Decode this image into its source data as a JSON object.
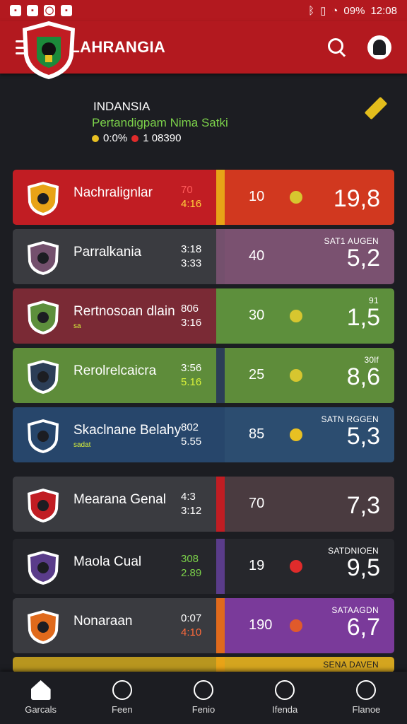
{
  "status_bar": {
    "time": "12:08",
    "battery": "09%"
  },
  "app": {
    "title": "OLAHRANGIA"
  },
  "team": {
    "name": "INDANSIA",
    "subtitle": "Pertandigpam Nima Satki",
    "stat1": "0:0%",
    "stat2": "1 08390"
  },
  "matches": [
    {
      "name": "Nachralignlar",
      "small": "",
      "time1": "70",
      "time2": "4:16",
      "num": "10",
      "tag": "",
      "score": "19,8",
      "left": "#c11d23",
      "divider": "#e8a317",
      "right": "#d1381f",
      "timecolor1": "#ff5a5a",
      "timecolor2": "#ffcf3a",
      "symbol": "#d7c62f"
    },
    {
      "name": "Parralkania",
      "small": "",
      "time1": "3:18",
      "time2": "3:33",
      "num": "40",
      "tag": "SAT1 AUGEN",
      "score": "5,2",
      "left": "#3a3b40",
      "divider": "#74506d",
      "right": "#7a5170",
      "timecolor1": "#ffffff",
      "timecolor2": "#ffffff",
      "symbol": ""
    },
    {
      "name": "Rertnosoan dlain",
      "small": "sa",
      "time1": "806",
      "time2": "3:16",
      "num": "30",
      "tag": "91",
      "score": "1,5",
      "left": "#7a2a35",
      "divider": "#5d8f3c",
      "right": "#5d8f3c",
      "timecolor1": "#ffffff",
      "timecolor2": "#ffffff",
      "symbol": "#d7c62f"
    },
    {
      "name": "Rerolrelcaicra",
      "small": "",
      "time1": "3:56",
      "time2": "5.16",
      "num": "25",
      "tag": "30lf",
      "score": "8,6",
      "left": "#5e8c3a",
      "divider": "#2c3e57",
      "right": "#5e8c3a",
      "timecolor1": "#ffffff",
      "timecolor2": "#d7f03a",
      "symbol": "#d7c62f"
    },
    {
      "name": "Skaclnane Belahy",
      "small": "sadat",
      "time1": "802",
      "time2": "5.55",
      "num": "85",
      "tag": "SATN RGGEN",
      "score": "5,3",
      "left": "#27466b",
      "divider": "#27466b",
      "right": "#2c4d70",
      "timecolor1": "#ffffff",
      "timecolor2": "#ffffff",
      "symbol": "#e8c022"
    },
    {
      "name": "Mearana Genal",
      "small": "",
      "time1": "4:3",
      "time2": "3:12",
      "num": "70",
      "tag": "",
      "score": "7,3",
      "left": "#3a3b40",
      "divider": "#c11d23",
      "right": "#4a3b40",
      "timecolor1": "#ffffff",
      "timecolor2": "#ffffff",
      "symbol": ""
    },
    {
      "name": "Maola Cual",
      "small": "",
      "time1": "308",
      "time2": "2.89",
      "num": "19",
      "tag": "SATDNIOEN",
      "score": "9,5",
      "left": "#26272c",
      "divider": "#5a3c8a",
      "right": "#26272c",
      "timecolor1": "#7bd14a",
      "timecolor2": "#7bd14a",
      "symbol": "#e02b2b"
    },
    {
      "name": "Nonaraan",
      "small": "",
      "time1": "0:07",
      "time2": "4:10",
      "num": "190",
      "tag": "SATAAGDN",
      "score": "6,7",
      "left": "#3a3b40",
      "divider": "#e06a1c",
      "right": "#7a3a9a",
      "timecolor1": "#ffffff",
      "timecolor2": "#ff6a3a",
      "symbol": "#e05a2b"
    }
  ],
  "partial_row": {
    "tag": "SENA DAVEN"
  },
  "nav": [
    {
      "label": "Garcals",
      "icon": "home-icon"
    },
    {
      "label": "Feen",
      "icon": "bull-icon"
    },
    {
      "label": "Fenio",
      "icon": "clock-icon"
    },
    {
      "label": "Ifenda",
      "icon": "location-icon"
    },
    {
      "label": "Flanoe",
      "icon": "profile-icon"
    }
  ]
}
